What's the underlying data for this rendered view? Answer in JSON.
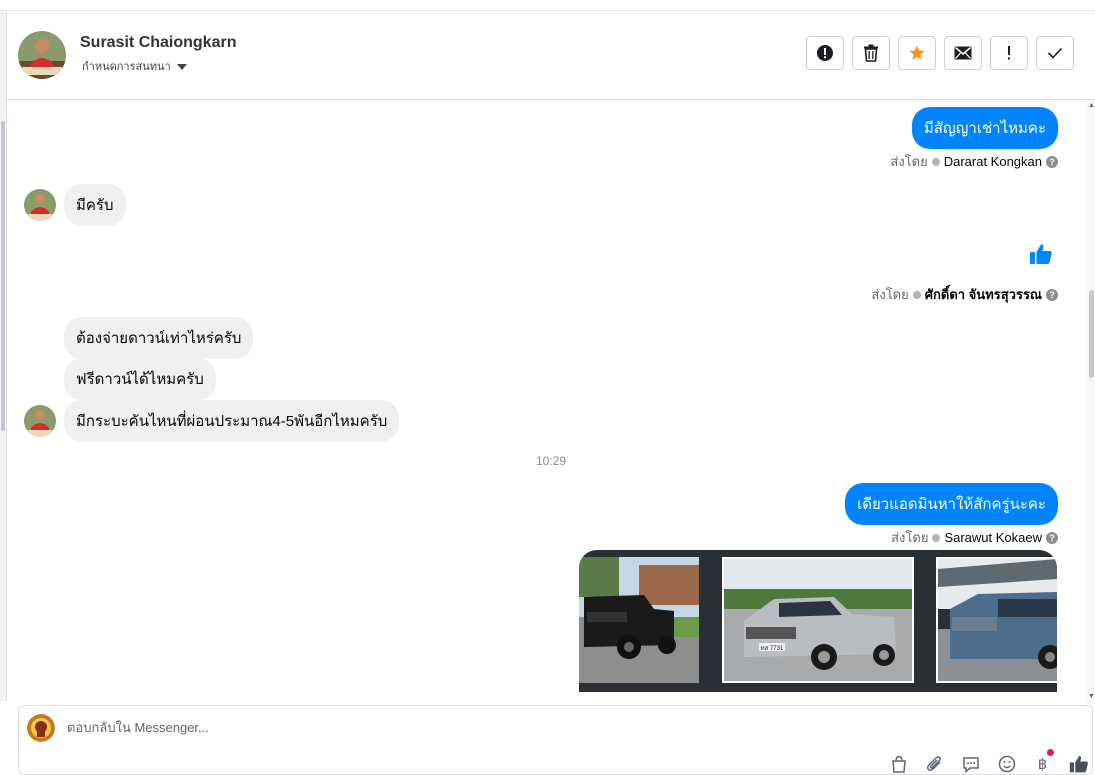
{
  "header": {
    "contact_name": "Surasit Chaiongkarn",
    "assign_label": "กำหนดการสนทนา",
    "actions": [
      "spam",
      "delete",
      "star",
      "mark-unread",
      "important",
      "done"
    ]
  },
  "messages": {
    "m1_text": "มีสัญญาเช่าไหมคะ",
    "m1_sent_prefix": "ส่งโดย",
    "m1_sender": "Dararat Kongkan",
    "m2_text": "มีครับ",
    "m3_sent_prefix": "ส่งโดย",
    "m3_sender": "ศักดิ์ดา จันทรสุวรรณ",
    "m4_text": "ต้องจ่ายดาวน์เท่าไหร่ครับ",
    "m5_text": "ฟรีดาวน์ได้ไหมครับ",
    "m6_text": "มีกระบะคันไหนที่ผ่อนประมาณ4-5พันอีกไหมครับ",
    "timestamp": "10:29",
    "m7_text": "เดียวแอดมินหาให้สักครู่นะคะ",
    "m7_sent_prefix": "ส่งโดย",
    "m7_sender": "Sarawut Kokaew",
    "photo3_plate": "ทส 7731"
  },
  "composer": {
    "placeholder": "ตอบกลับใน Messenger..."
  },
  "colors": {
    "accent": "#0084ff",
    "star": "#f7931e",
    "incoming_bubble": "#f0f0f0"
  }
}
